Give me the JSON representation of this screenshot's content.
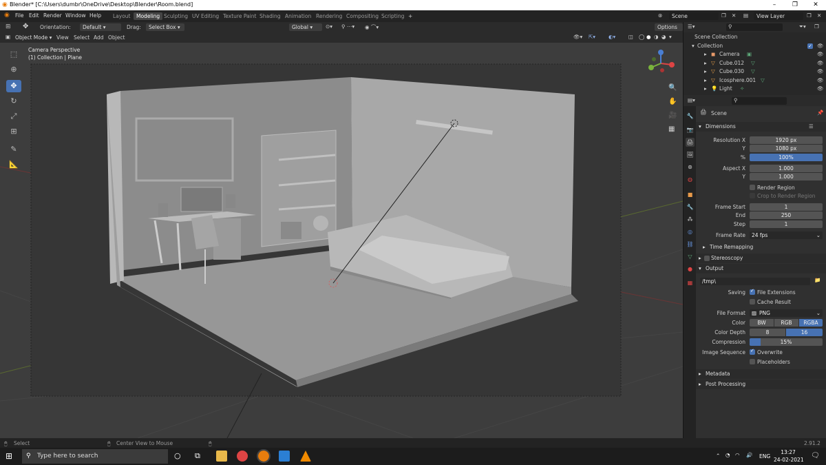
{
  "window": {
    "title": "Blender* [C:\\Users\\dumbr\\OneDrive\\Desktop\\Blender\\Room.blend]"
  },
  "menu": [
    "File",
    "Edit",
    "Render",
    "Window",
    "Help"
  ],
  "workspaces": [
    "Layout",
    "Modeling",
    "Sculpting",
    "UV Editing",
    "Texture Paint",
    "Shading",
    "Animation",
    "Rendering",
    "Compositing",
    "Scripting"
  ],
  "active_workspace": "Modeling",
  "scene_field": "Scene",
  "view_layer_field": "View Layer",
  "tool_header": {
    "orientation_label": "Orientation:",
    "orientation_value": "Default",
    "drag_label": "Drag:",
    "drag_value": "Select Box",
    "transform_orientation": "Global",
    "options": "Options"
  },
  "viewport_header": {
    "mode": "Object Mode",
    "menus": [
      "View",
      "Select",
      "Add",
      "Object"
    ]
  },
  "viewport": {
    "camera_label": "Camera Perspective",
    "collection_label": "(1) Collection | Plane"
  },
  "outliner": {
    "root": "Scene Collection",
    "collection": "Collection",
    "items": [
      "Camera",
      "Cube.012",
      "Cube.030",
      "Icosphere.001",
      "Light"
    ]
  },
  "properties": {
    "context": "Scene",
    "dimensions": {
      "title": "Dimensions",
      "resolution_x_label": "Resolution X",
      "resolution_x": "1920 px",
      "resolution_y_label": "Y",
      "resolution_y": "1080 px",
      "percent_label": "%",
      "percent": "100%",
      "aspect_x_label": "Aspect X",
      "aspect_x": "1.000",
      "aspect_y_label": "Y",
      "aspect_y": "1.000",
      "render_region": "Render Region",
      "crop_region": "Crop to Render Region",
      "frame_start_label": "Frame Start",
      "frame_start": "1",
      "end_label": "End",
      "end": "250",
      "step_label": "Step",
      "step": "1",
      "frame_rate_label": "Frame Rate",
      "frame_rate": "24 fps",
      "time_remapping": "Time Remapping"
    },
    "stereoscopy": "Stereoscopy",
    "output": {
      "title": "Output",
      "path": "/tmp\\",
      "saving_label": "Saving",
      "file_extensions": "File Extensions",
      "cache_result": "Cache Result",
      "file_format_label": "File Format",
      "file_format": "PNG",
      "color_label": "Color",
      "color_options": [
        "BW",
        "RGB",
        "RGBA"
      ],
      "color_active": "RGBA",
      "color_depth_label": "Color Depth",
      "color_depth_options": [
        "8",
        "16"
      ],
      "color_depth_active": "16",
      "compression_label": "Compression",
      "compression": "15%",
      "compression_fraction": 0.15,
      "image_sequence_label": "Image Sequence",
      "overwrite": "Overwrite",
      "placeholders": "Placeholders"
    },
    "metadata": "Metadata",
    "post_processing": "Post Processing"
  },
  "statusbar": {
    "select": "Select",
    "center": "Center View to Mouse",
    "version": "2.91.2"
  },
  "taskbar": {
    "search_placeholder": "Type here to search",
    "lang": "ENG",
    "time": "13:27",
    "date": "24-02-2021"
  }
}
